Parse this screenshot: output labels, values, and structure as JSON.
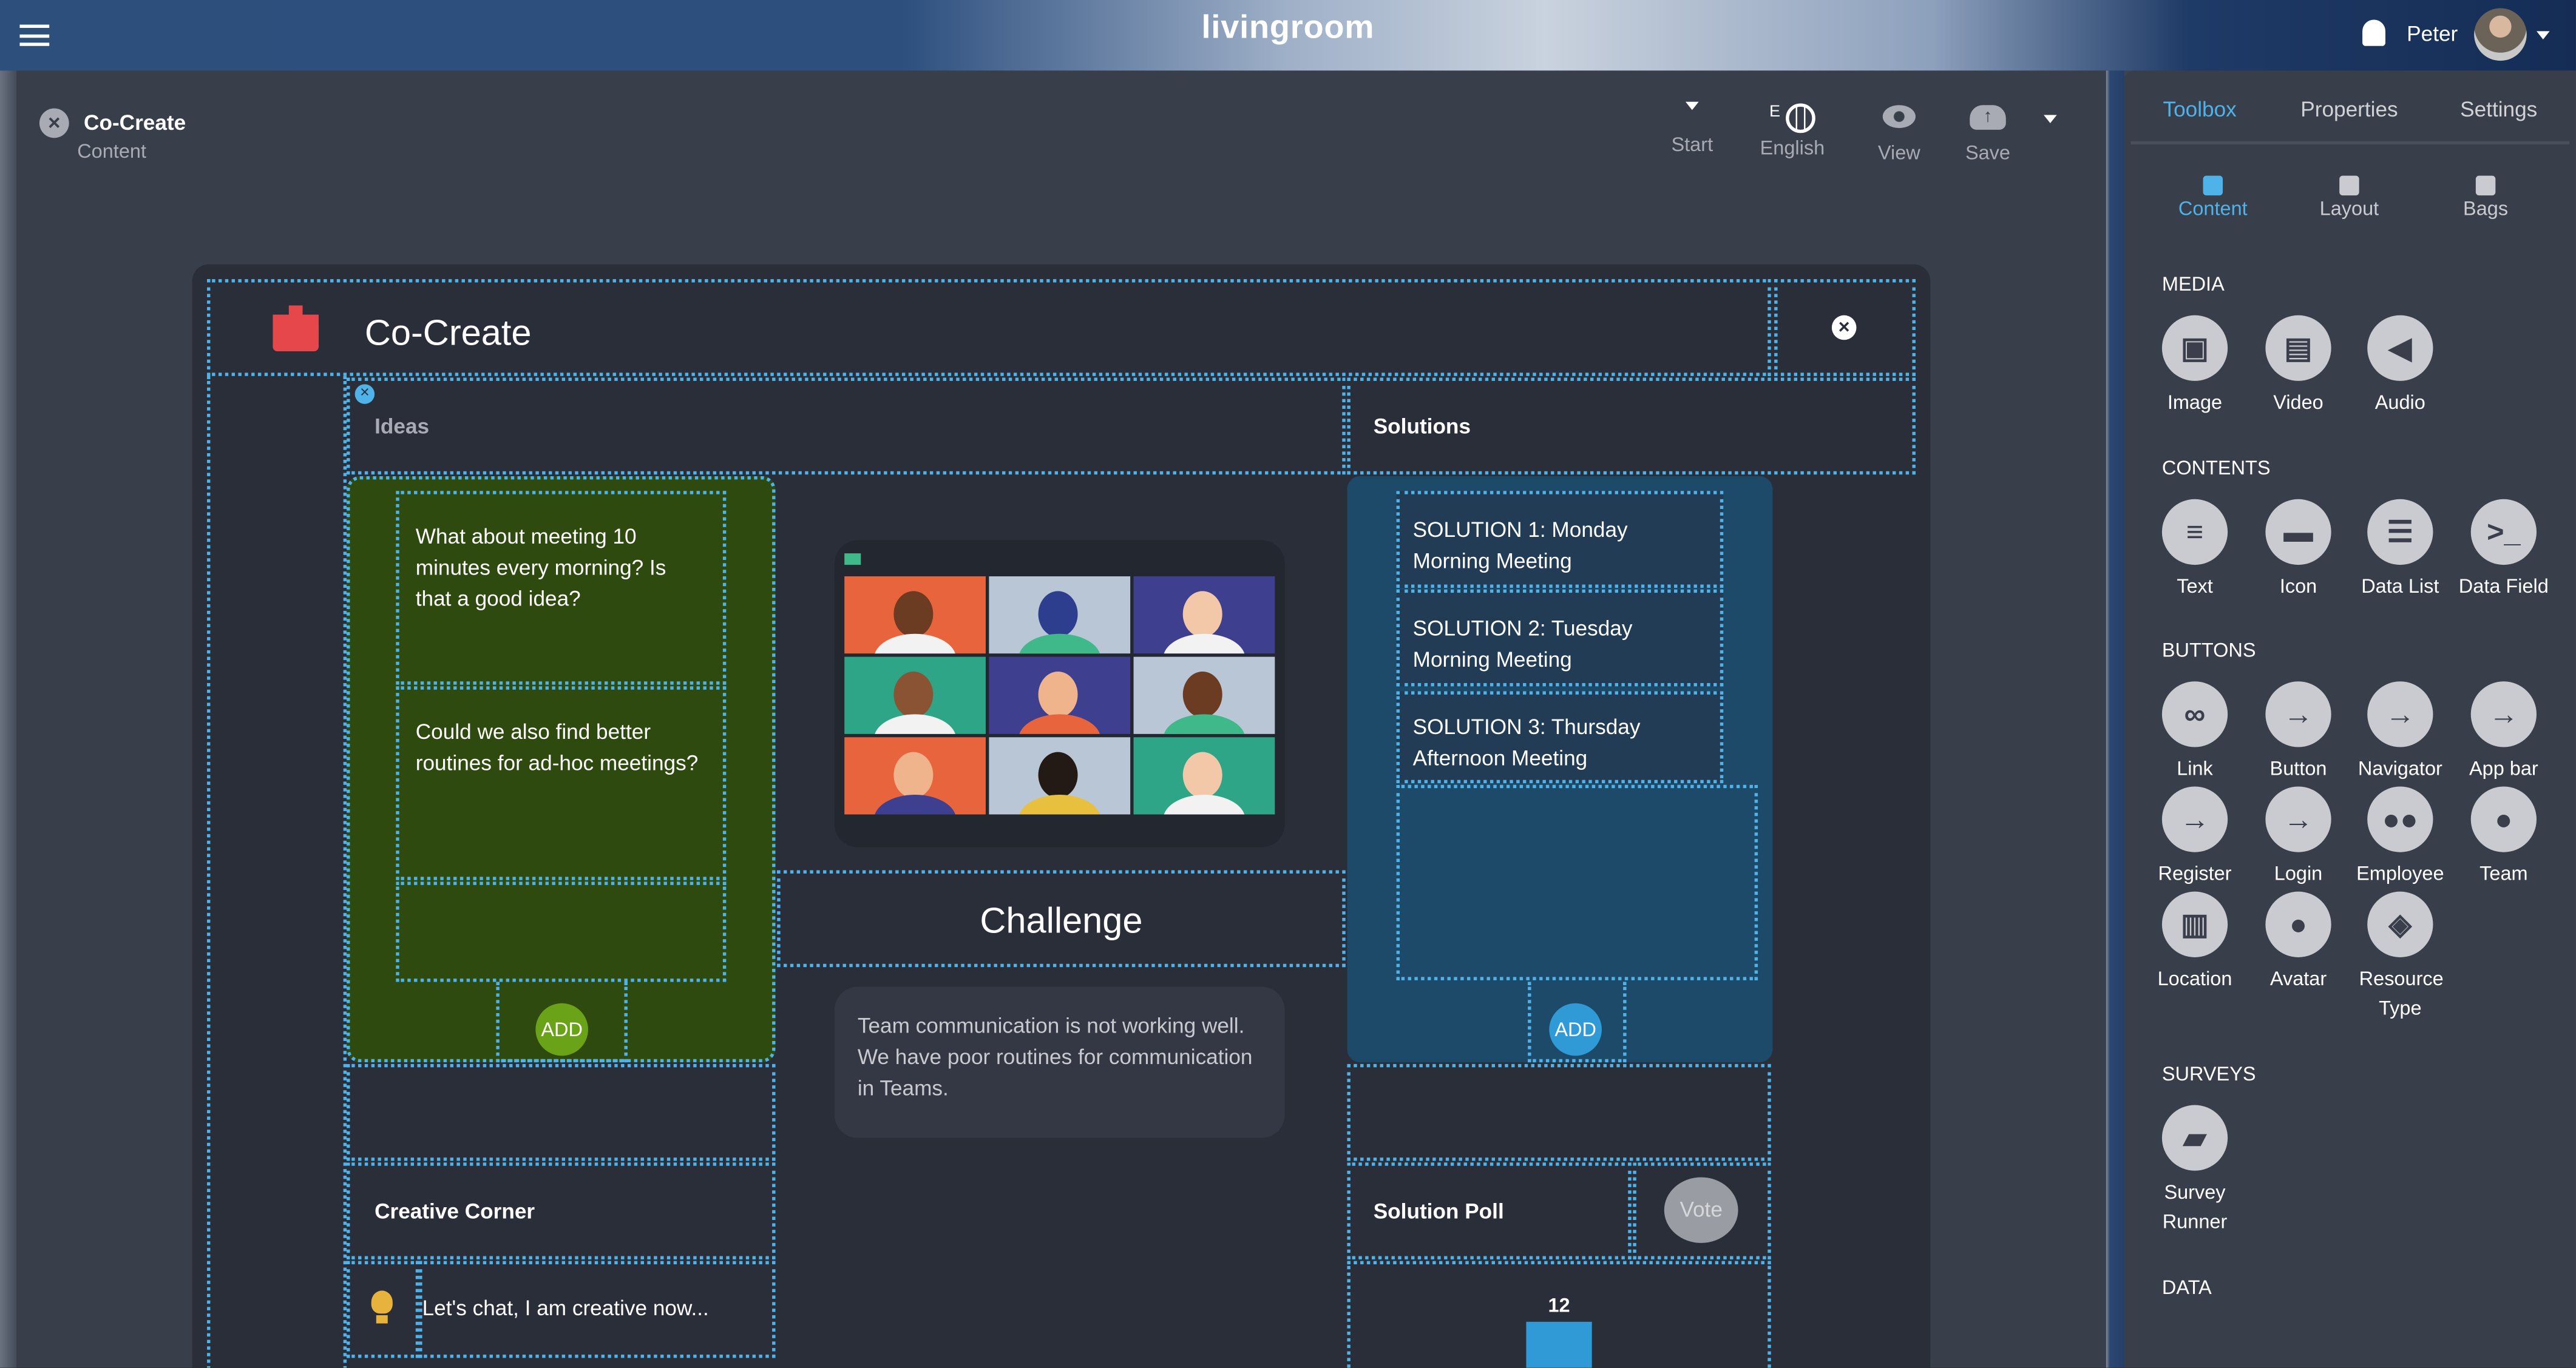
{
  "topbar": {
    "logo": "livingroom",
    "user": "Peter"
  },
  "header": {
    "title": "Co-Create",
    "subtitle": "Content"
  },
  "toolbar": {
    "start": "Start",
    "language_code": "E",
    "language": "English",
    "view": "View",
    "save": "Save"
  },
  "canvas": {
    "title": "Co-Create",
    "ideas": {
      "header": "Ideas",
      "cards": [
        "What about meeting 10 minutes every morning? Is that a good idea?",
        "Could we also find better routines for ad-hoc meetings?",
        ""
      ],
      "add": "ADD"
    },
    "solutions": {
      "header": "Solutions",
      "cards": [
        "SOLUTION 1: Monday Morning Meeting",
        "SOLUTION 2: Tuesday Morning Meeting",
        "SOLUTION 3: Thursday Afternoon Meeting"
      ],
      "add": "ADD"
    },
    "challenge": {
      "title": "Challenge",
      "text": "Team communication is not working well. We have poor routines for communication in Teams."
    },
    "creative": {
      "header": "Creative Corner",
      "chat": "Let's chat, I am creative now..."
    },
    "poll": {
      "header": "Solution Poll",
      "vote": "Vote"
    },
    "colors": {
      "ideas": "#2f4a0e",
      "solutions": "#1d4a68",
      "accent": "#4fb3ea",
      "add_green": "#6aa318",
      "add_blue": "#2f9ad6"
    }
  },
  "chart_data": {
    "type": "bar",
    "categories": [
      ""
    ],
    "values": [
      12
    ],
    "data_labels": [
      "12"
    ]
  },
  "panel": {
    "tabs": [
      "Toolbox",
      "Properties",
      "Settings"
    ],
    "active_tab": "Toolbox",
    "subtabs": [
      "Content",
      "Layout",
      "Bags"
    ],
    "active_subtab": "Content",
    "sections": [
      {
        "title": "MEDIA",
        "items": [
          {
            "label": "Image",
            "icon": "image-icon"
          },
          {
            "label": "Video",
            "icon": "film-icon"
          },
          {
            "label": "Audio",
            "icon": "speaker-icon"
          }
        ]
      },
      {
        "title": "CONTENTS",
        "items": [
          {
            "label": "Text",
            "icon": "text-lines-icon"
          },
          {
            "label": "Icon",
            "icon": "car-icon"
          },
          {
            "label": "Data List",
            "icon": "list-icon"
          },
          {
            "label": "Data Field",
            "icon": "terminal-icon"
          }
        ]
      },
      {
        "title": "BUTTONS",
        "items": [
          {
            "label": "Link",
            "icon": "link-icon"
          },
          {
            "label": "Button",
            "icon": "sign-in-icon"
          },
          {
            "label": "Navigator",
            "icon": "sign-in-icon"
          },
          {
            "label": "App bar",
            "icon": "sign-in-icon"
          },
          {
            "label": "Register",
            "icon": "sign-in-icon"
          },
          {
            "label": "Login",
            "icon": "sign-in-icon"
          },
          {
            "label": "Employee",
            "icon": "people-icon"
          },
          {
            "label": "Team",
            "icon": "person-icon"
          },
          {
            "label": "Location",
            "icon": "building-icon"
          },
          {
            "label": "Avatar",
            "icon": "person-icon"
          },
          {
            "label": "Resource Type",
            "icon": "cubes-icon"
          }
        ]
      },
      {
        "title": "SURVEYS",
        "items": [
          {
            "label": "Survey Runner",
            "icon": "chat-icon"
          }
        ]
      },
      {
        "title": "DATA",
        "items": []
      }
    ]
  }
}
